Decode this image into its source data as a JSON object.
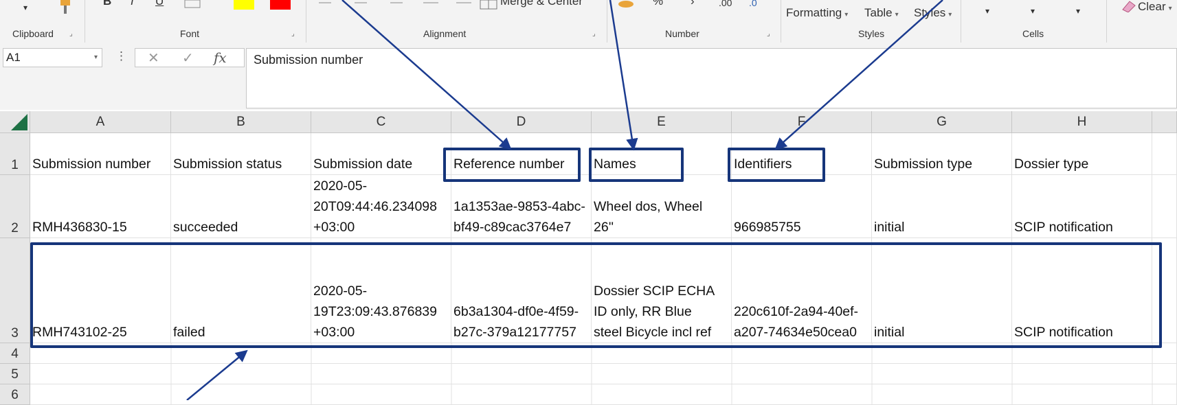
{
  "ribbon": {
    "groups": [
      "Clipboard",
      "Font",
      "Alignment",
      "Number",
      "Styles",
      "Cells"
    ],
    "alignment_merge_label": "Merge & Center",
    "number_decimal_increase": ".00",
    "number_decimal_decrease": ".0",
    "number_percent": "%",
    "styles_formatting": "Formatting",
    "styles_table": "Table",
    "styles_cell_styles": "Styles",
    "editing_clear": "Clear",
    "colors": {
      "highlight": "#ffff00",
      "font_color": "#ff0000"
    }
  },
  "formula_bar": {
    "name_box": "A1",
    "formula": "Submission number",
    "fx_label": "fx",
    "cancel_glyph": "✕",
    "enter_glyph": "✓",
    "dots": "⋮"
  },
  "columns": [
    "A",
    "B",
    "C",
    "D",
    "E",
    "F",
    "G",
    "H"
  ],
  "rows": [
    "1",
    "2",
    "3",
    "4",
    "5",
    "6"
  ],
  "table": {
    "header": [
      "Submission number",
      "Submission status",
      "Submission date",
      "Reference number",
      "Names",
      "Identifiers",
      "Submission type",
      "Dossier type"
    ],
    "row2": {
      "a": "RMH436830-15",
      "b": "succeeded",
      "c": [
        "2020-05-",
        "20T09:44:46.234098",
        "+03:00"
      ],
      "d": [
        "1a1353ae-9853-4abc-",
        "bf49-c89cac3764e7"
      ],
      "e": [
        "Wheel dos, Wheel",
        "26''"
      ],
      "f": "966985755",
      "g": "initial",
      "h": "SCIP notification"
    },
    "row3": {
      "a": "RMH743102-25",
      "b": "failed",
      "c": [
        "2020-05-",
        "19T23:09:43.876839",
        "+03:00"
      ],
      "d": [
        "6b3a1304-df0e-4f59-",
        "b27c-379a12177757"
      ],
      "e": [
        "Dossier SCIP ECHA",
        "ID only, RR Blue",
        "steel Bicycle incl ref"
      ],
      "f": [
        "220c610f-2a94-40ef-",
        "a207-74634e50cea0"
      ],
      "g": "initial",
      "h": "SCIP notification"
    }
  },
  "annotation_color": "#16357a"
}
